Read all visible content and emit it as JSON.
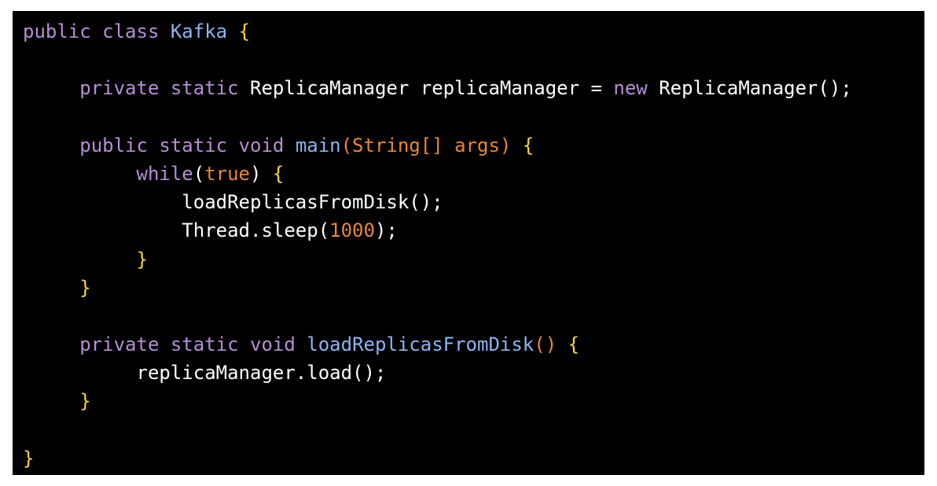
{
  "theme": {
    "background": "#000000",
    "page_background": "#ffffff",
    "colors": {
      "keyword": "#b58fd6",
      "type": "#8fb3f0",
      "function": "#8fb3f0",
      "param": "#e8863a",
      "number": "#e8863a",
      "literal": "#e8863a",
      "plain": "#ffffff",
      "punct": "#ffffff",
      "brace": "#f5d547"
    }
  },
  "code": {
    "language": "java",
    "lines": [
      [
        {
          "t": "public",
          "k": "keyword"
        },
        {
          "t": " ",
          "k": "plain"
        },
        {
          "t": "class",
          "k": "keyword"
        },
        {
          "t": " ",
          "k": "plain"
        },
        {
          "t": "Kafka",
          "k": "type"
        },
        {
          "t": " ",
          "k": "plain"
        },
        {
          "t": "{",
          "k": "brace"
        }
      ],
      [],
      [
        {
          "t": "     ",
          "k": "plain"
        },
        {
          "t": "private",
          "k": "keyword"
        },
        {
          "t": " ",
          "k": "plain"
        },
        {
          "t": "static",
          "k": "keyword"
        },
        {
          "t": " ReplicaManager replicaManager = ",
          "k": "plain"
        },
        {
          "t": "new",
          "k": "keyword"
        },
        {
          "t": " ReplicaManager",
          "k": "plain"
        },
        {
          "t": "();",
          "k": "punct"
        }
      ],
      [],
      [
        {
          "t": "     ",
          "k": "plain"
        },
        {
          "t": "public",
          "k": "keyword"
        },
        {
          "t": " ",
          "k": "plain"
        },
        {
          "t": "static",
          "k": "keyword"
        },
        {
          "t": " ",
          "k": "plain"
        },
        {
          "t": "void",
          "k": "keyword"
        },
        {
          "t": " ",
          "k": "plain"
        },
        {
          "t": "main",
          "k": "function"
        },
        {
          "t": "(String[] args)",
          "k": "param"
        },
        {
          "t": " ",
          "k": "plain"
        },
        {
          "t": "{",
          "k": "brace"
        }
      ],
      [
        {
          "t": "          ",
          "k": "plain"
        },
        {
          "t": "while",
          "k": "keyword"
        },
        {
          "t": "(",
          "k": "punct"
        },
        {
          "t": "true",
          "k": "literal"
        },
        {
          "t": ") ",
          "k": "punct"
        },
        {
          "t": "{",
          "k": "brace"
        }
      ],
      [
        {
          "t": "              ",
          "k": "plain"
        },
        {
          "t": "loadReplicasFromDisk();",
          "k": "plain"
        }
      ],
      [
        {
          "t": "              ",
          "k": "plain"
        },
        {
          "t": "Thread.sleep(",
          "k": "plain"
        },
        {
          "t": "1000",
          "k": "number"
        },
        {
          "t": ");",
          "k": "punct"
        }
      ],
      [
        {
          "t": "          ",
          "k": "plain"
        },
        {
          "t": "}",
          "k": "brace"
        }
      ],
      [
        {
          "t": "     ",
          "k": "plain"
        },
        {
          "t": "}",
          "k": "brace"
        }
      ],
      [],
      [
        {
          "t": "     ",
          "k": "plain"
        },
        {
          "t": "private",
          "k": "keyword"
        },
        {
          "t": " ",
          "k": "plain"
        },
        {
          "t": "static",
          "k": "keyword"
        },
        {
          "t": " ",
          "k": "plain"
        },
        {
          "t": "void",
          "k": "keyword"
        },
        {
          "t": " ",
          "k": "plain"
        },
        {
          "t": "loadReplicasFromDisk",
          "k": "function"
        },
        {
          "t": "()",
          "k": "param"
        },
        {
          "t": " ",
          "k": "plain"
        },
        {
          "t": "{",
          "k": "brace"
        }
      ],
      [
        {
          "t": "          ",
          "k": "plain"
        },
        {
          "t": "replicaManager.load();",
          "k": "plain"
        }
      ],
      [
        {
          "t": "     ",
          "k": "plain"
        },
        {
          "t": "}",
          "k": "brace"
        }
      ],
      [],
      [
        {
          "t": "}",
          "k": "brace"
        }
      ]
    ]
  }
}
